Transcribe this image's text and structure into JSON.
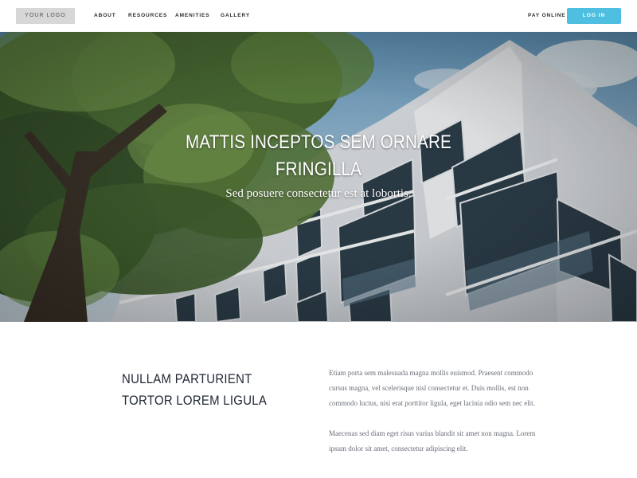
{
  "header": {
    "logo_text": "YOUR LOGO",
    "nav": [
      "ABOUT",
      "RESOURCES",
      "AMENITIES",
      "GALLERY"
    ],
    "pay_online": "PAY ONLINE",
    "login": "LOG IN",
    "accent": "#4fbfe1"
  },
  "hero": {
    "title": "MATTIS INCEPTOS SEM ORNARE FRINGILLA",
    "subtitle": "Sed posuere consectetur est at lobortis."
  },
  "content": {
    "heading": "NULLAM PARTURIENT TORTOR LOREM LIGULA",
    "paragraph1": "Etiam porta sem malesuada magna mollis euismod. Praesent commodo cursus magna, vel scelerisque nisl consectetur et. Duis mollis, est non commodo luctus, nisi erat porttitor ligula, eget lacinia odio sem nec elit.",
    "paragraph2": "Maecenas sed diam eget risus varius blandit sit amet non magna. Lorem ipsum dolor sit amet, consectetur adipiscing elit."
  }
}
